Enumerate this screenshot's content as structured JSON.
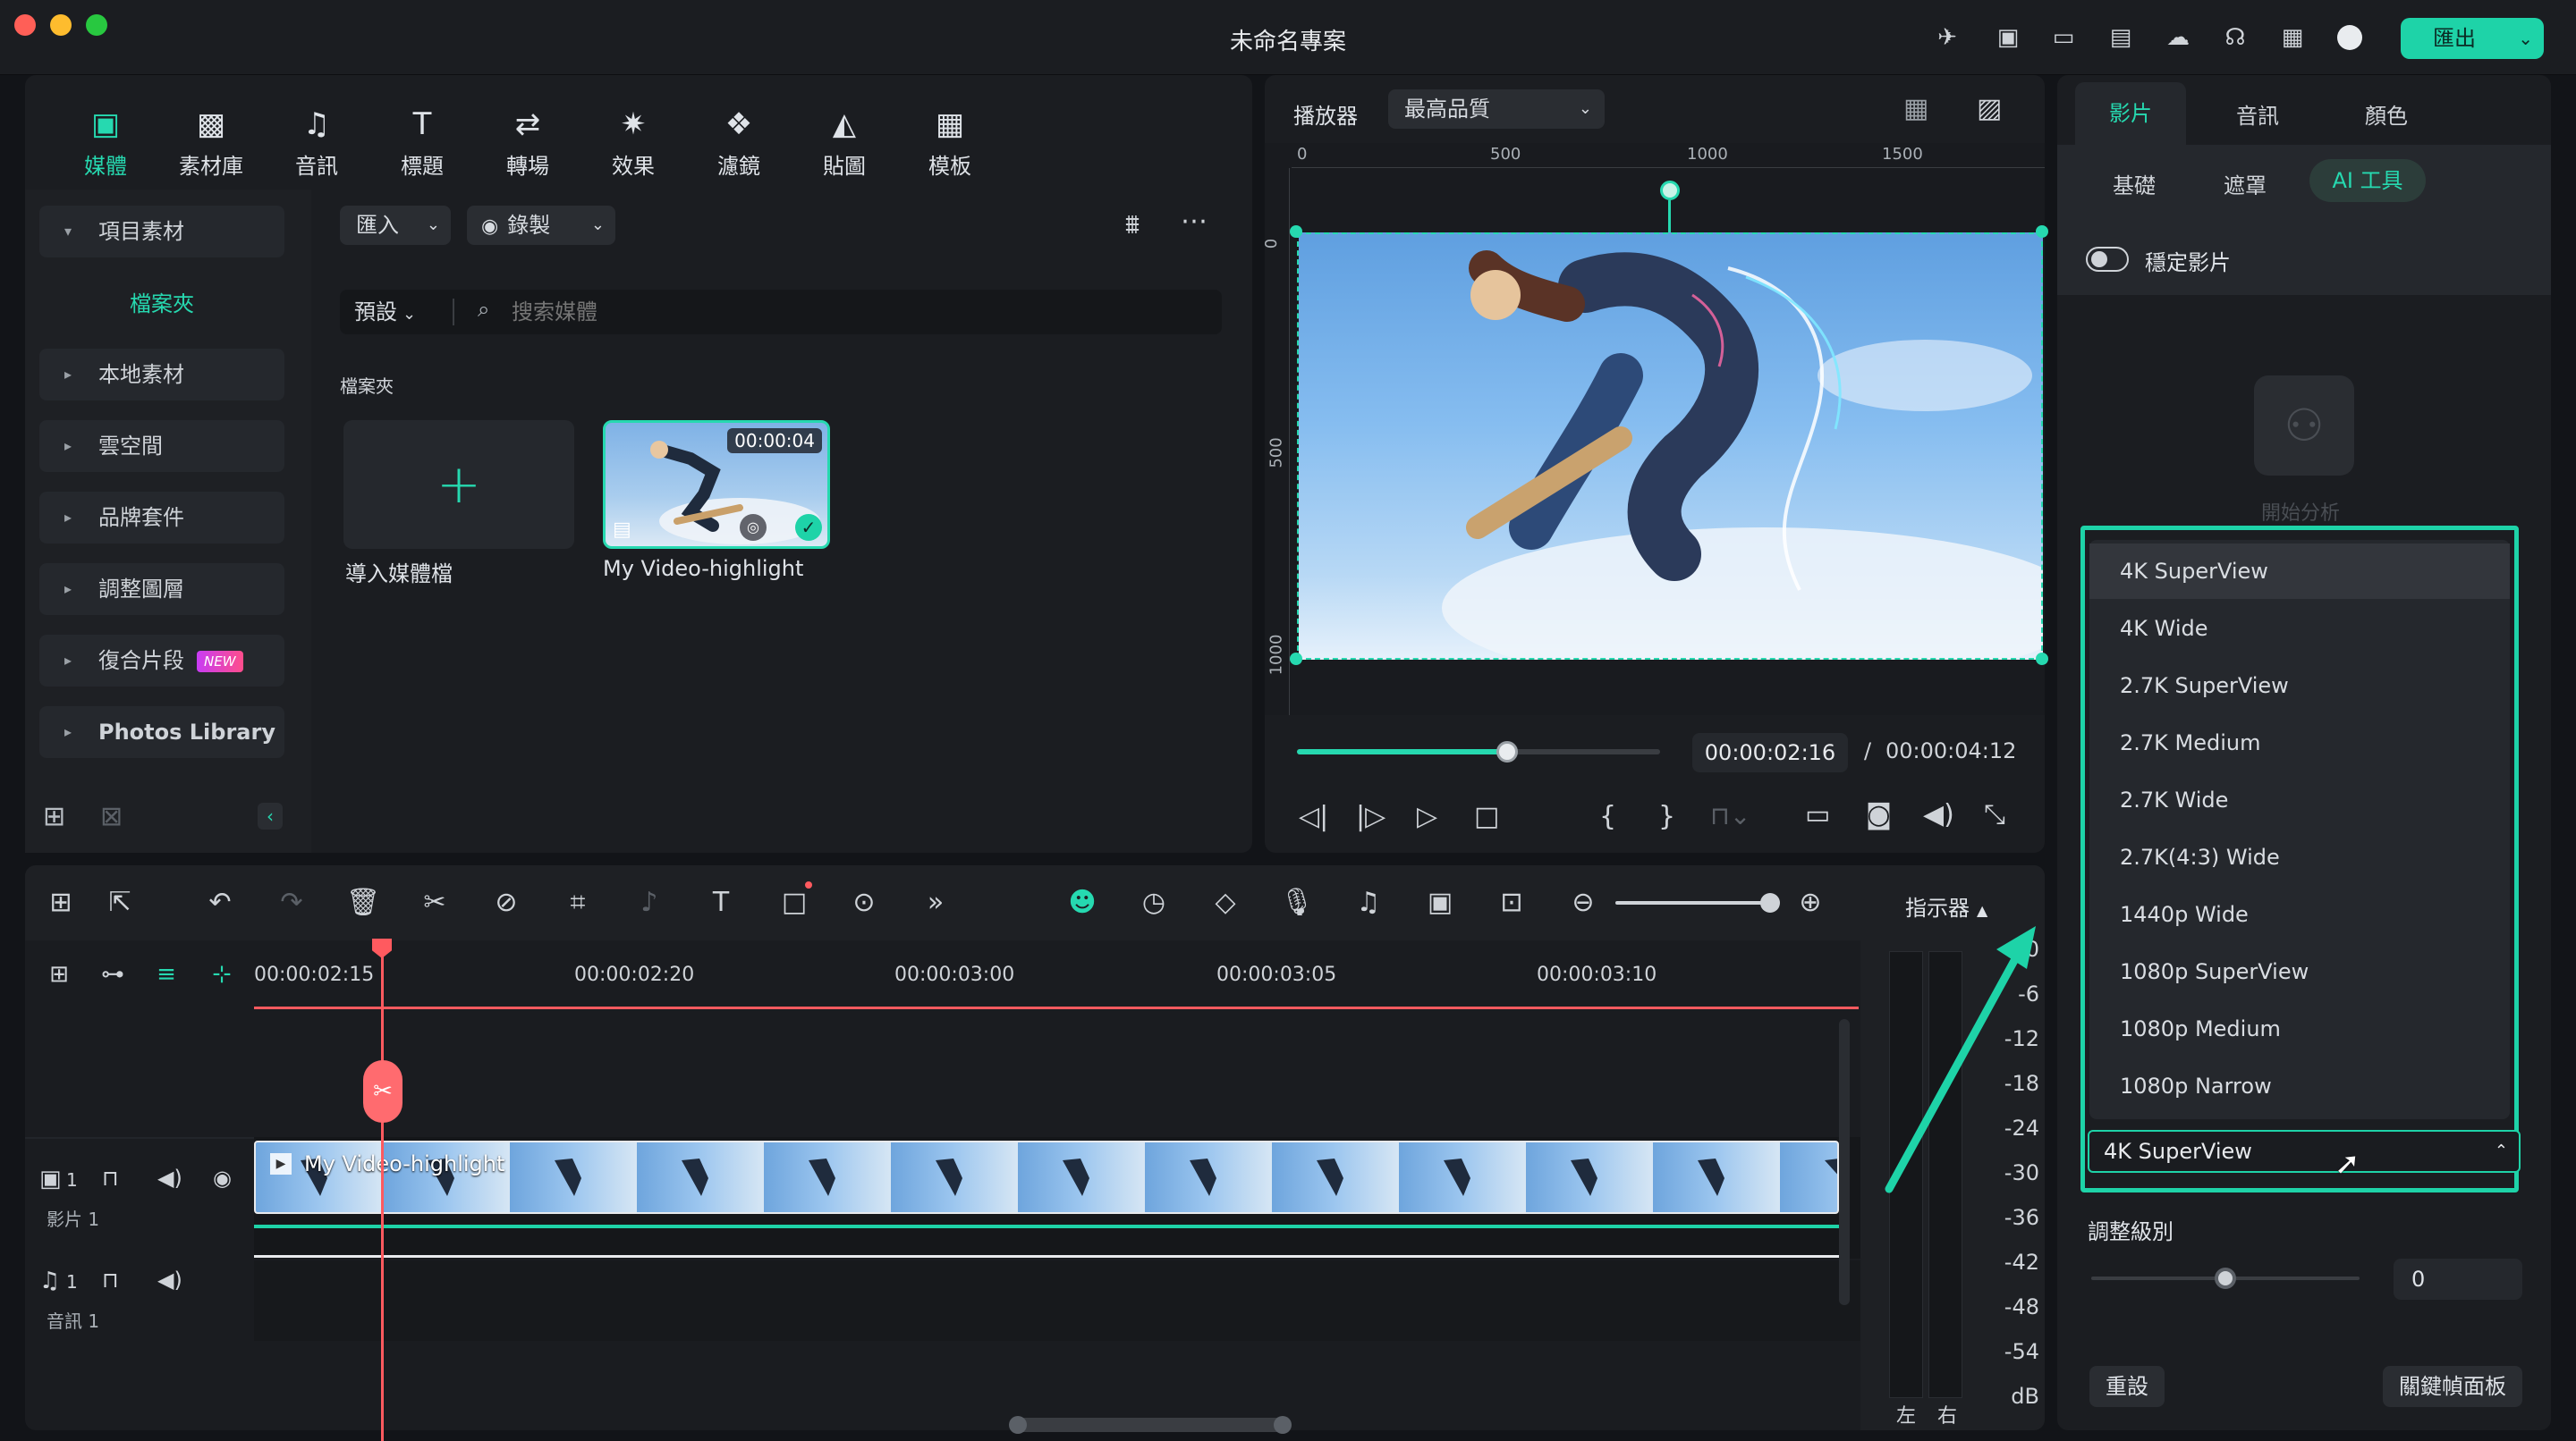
{
  "window": {
    "title": "未命名專案",
    "export_label": "匯出"
  },
  "toolbar": {
    "tabs": [
      "媒體",
      "素材庫",
      "音訊",
      "標題",
      "轉場",
      "效果",
      "濾鏡",
      "貼圖",
      "模板"
    ],
    "active": "媒體"
  },
  "sidebar": {
    "items": [
      "項目素材",
      "本地素材",
      "雲空間",
      "品牌套件",
      "調整圖層",
      "復合片段",
      "Photos Library"
    ],
    "folder_label": "檔案夾",
    "new_badge": "NEW"
  },
  "media": {
    "import_label": "匯入",
    "record_label": "錄製",
    "preset_label": "預設",
    "search_placeholder": "搜索媒體",
    "section_label": "檔案夾",
    "import_card_label": "導入媒體檔",
    "clip_name": "My Video-highlight",
    "clip_duration": "00:00:04"
  },
  "player": {
    "label": "播放器",
    "quality": "最高品質",
    "ruler_h": [
      "0",
      "500",
      "1000",
      "1500"
    ],
    "ruler_v": [
      "0",
      "500",
      "1000"
    ],
    "current_time": "00:00:02:16",
    "separator": "/",
    "total_time": "00:00:04:12",
    "progress": 0.58
  },
  "timeline": {
    "timecodes": [
      "00:00:02:15",
      "00:00:02:20",
      "00:00:03:00",
      "00:00:03:05",
      "00:00:03:10"
    ],
    "video_track_label": "影片 1",
    "audio_track_label": "音訊 1",
    "track_num": "1",
    "clip_label": "My Video-highlight",
    "meter_label": "指示器",
    "meter_scale": [
      "0",
      "-6",
      "-12",
      "-18",
      "-24",
      "-30",
      "-36",
      "-42",
      "-48",
      "-54",
      "dB"
    ],
    "meter_left": "左",
    "meter_right": "右"
  },
  "right_panel": {
    "tabs": [
      "影片",
      "音訊",
      "顏色"
    ],
    "subtabs": [
      "基礎",
      "遮罩",
      "AI 工具"
    ],
    "stabilize_label": "穩定影片",
    "analyze_label": "開始分析",
    "dropdown_options": [
      "4K SuperView",
      "4K Wide",
      "2.7K SuperView",
      "2.7K Medium",
      "2.7K Wide",
      "2.7K(4:3) Wide",
      "1440p Wide",
      "1080p SuperView",
      "1080p Medium",
      "1080p Narrow"
    ],
    "selected": "4K SuperView",
    "adjust_label": "調整級別",
    "adjust_value": "0",
    "reset_label": "重設",
    "keyframe_label": "關鍵幀面板"
  },
  "colors": {
    "accent": "#1ed3a8",
    "playhead": "#ff5a5f"
  }
}
